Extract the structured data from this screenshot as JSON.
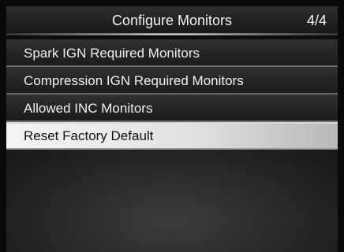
{
  "header": {
    "title": "Configure Monitors",
    "page_indicator": "4/4"
  },
  "menu": {
    "items": [
      {
        "label": "Spark IGN Required Monitors",
        "selected": false
      },
      {
        "label": "Compression IGN Required Monitors",
        "selected": false
      },
      {
        "label": "Allowed INC Monitors",
        "selected": false
      },
      {
        "label": "Reset Factory Default",
        "selected": true
      }
    ]
  },
  "colors": {
    "background": "#1a1a1a",
    "item_text": "#f0f0f0",
    "selected_background": "#e2e2e2",
    "selected_text": "#111111"
  }
}
